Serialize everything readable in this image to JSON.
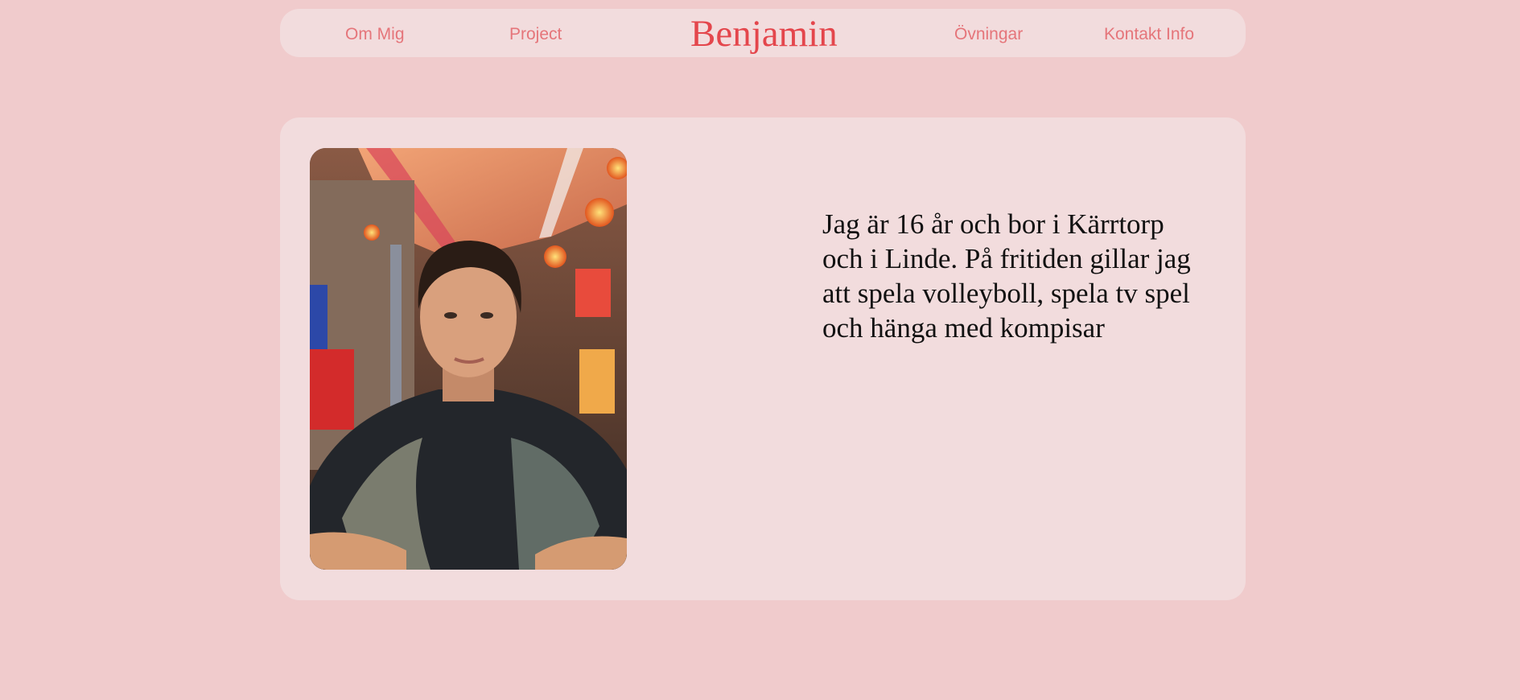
{
  "nav": {
    "links": [
      {
        "label": "Om Mig"
      },
      {
        "label": "Project"
      },
      {
        "label": "Övningar"
      },
      {
        "label": "Kontakt Info"
      }
    ],
    "brand": "Benjamin"
  },
  "about": {
    "bio": "Jag är 16 år och bor i Kärrtorp och i Linde. På fritiden gillar jag att spela volleyboll, spela tv spel och hänga med kompisar"
  },
  "colors": {
    "page_background": "#f0cbcc",
    "panel_background": "#f2dcdd",
    "nav_link": "#e5757a",
    "brand": "#e4464c",
    "body_text": "#111111"
  }
}
